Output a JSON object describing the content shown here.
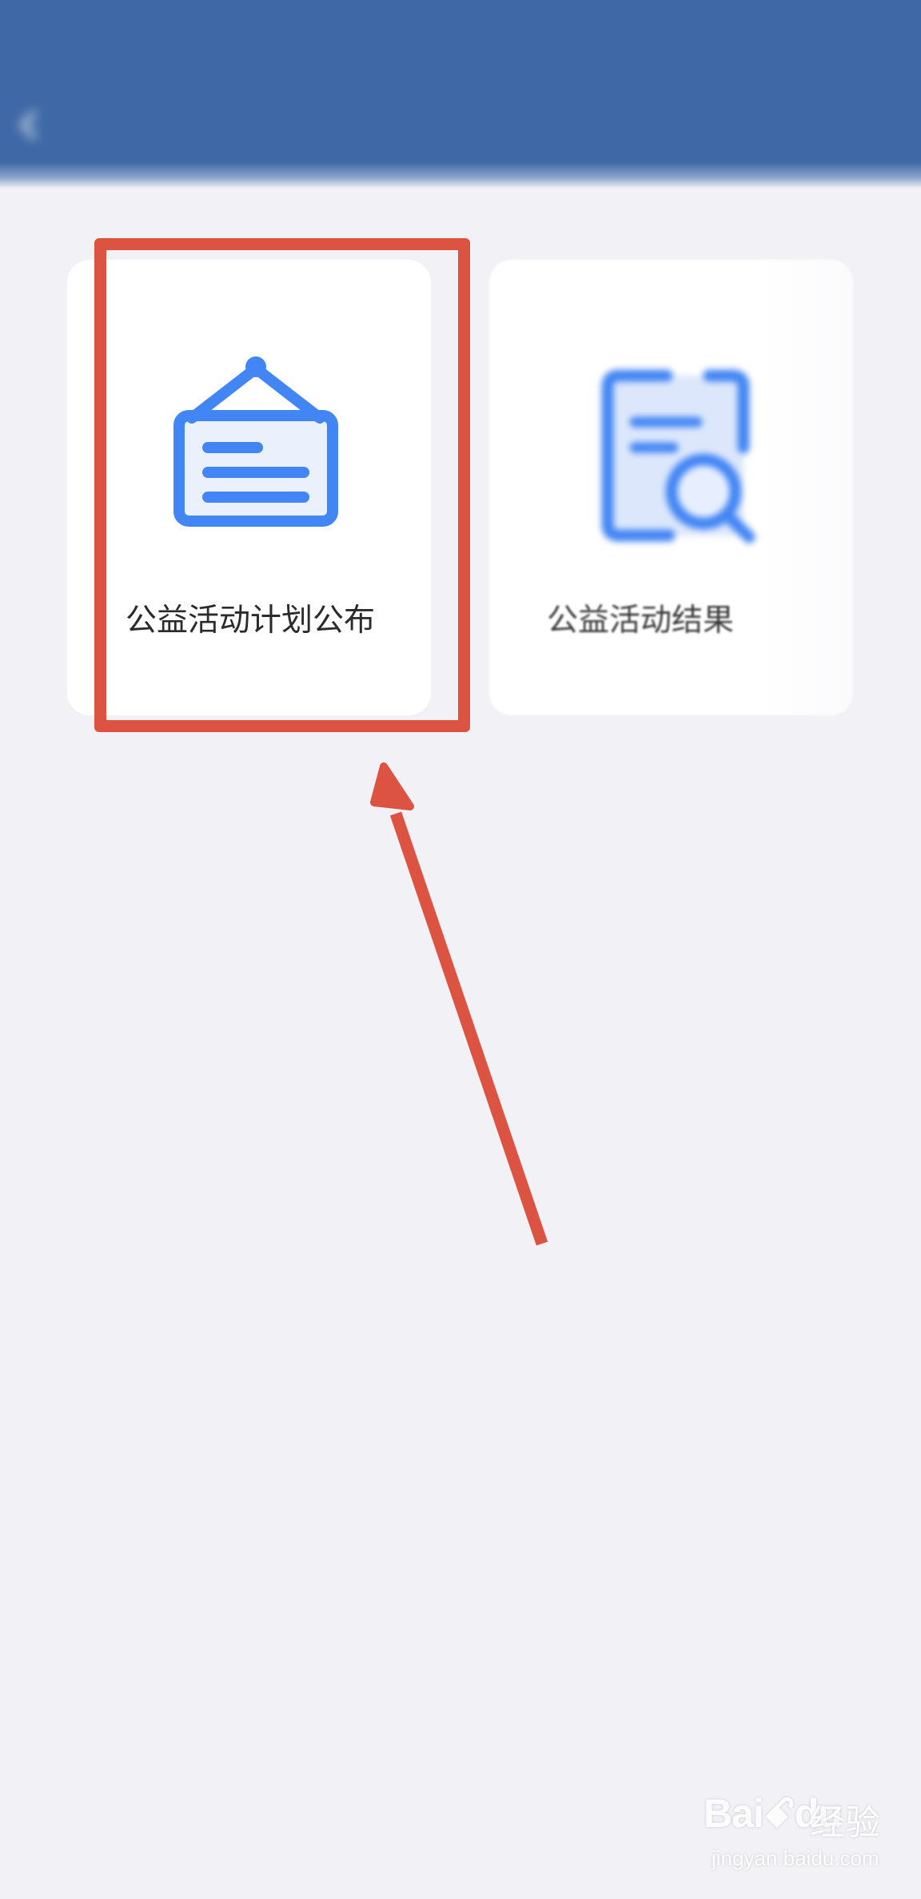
{
  "header": {
    "status_title": "",
    "status_right": "",
    "back_label": "",
    "title": ""
  },
  "cards": [
    {
      "label": "公益活动计划公布",
      "icon": "notice-board-icon"
    },
    {
      "label": "公益活动结果",
      "label_obscured": "",
      "icon": "document-search-icon"
    }
  ],
  "annotation": {
    "highlight_color": "#dc5342",
    "arrow_color": "#dc5342"
  },
  "colors": {
    "header_blue": "#3f69a6",
    "icon_blue": "#4285f4",
    "page_background": "#f2f1f6"
  },
  "watermark": {
    "brand": "Bai",
    "brand_suffix": "du",
    "chinese": "经验",
    "domain": "jingyan.baidu.com"
  }
}
